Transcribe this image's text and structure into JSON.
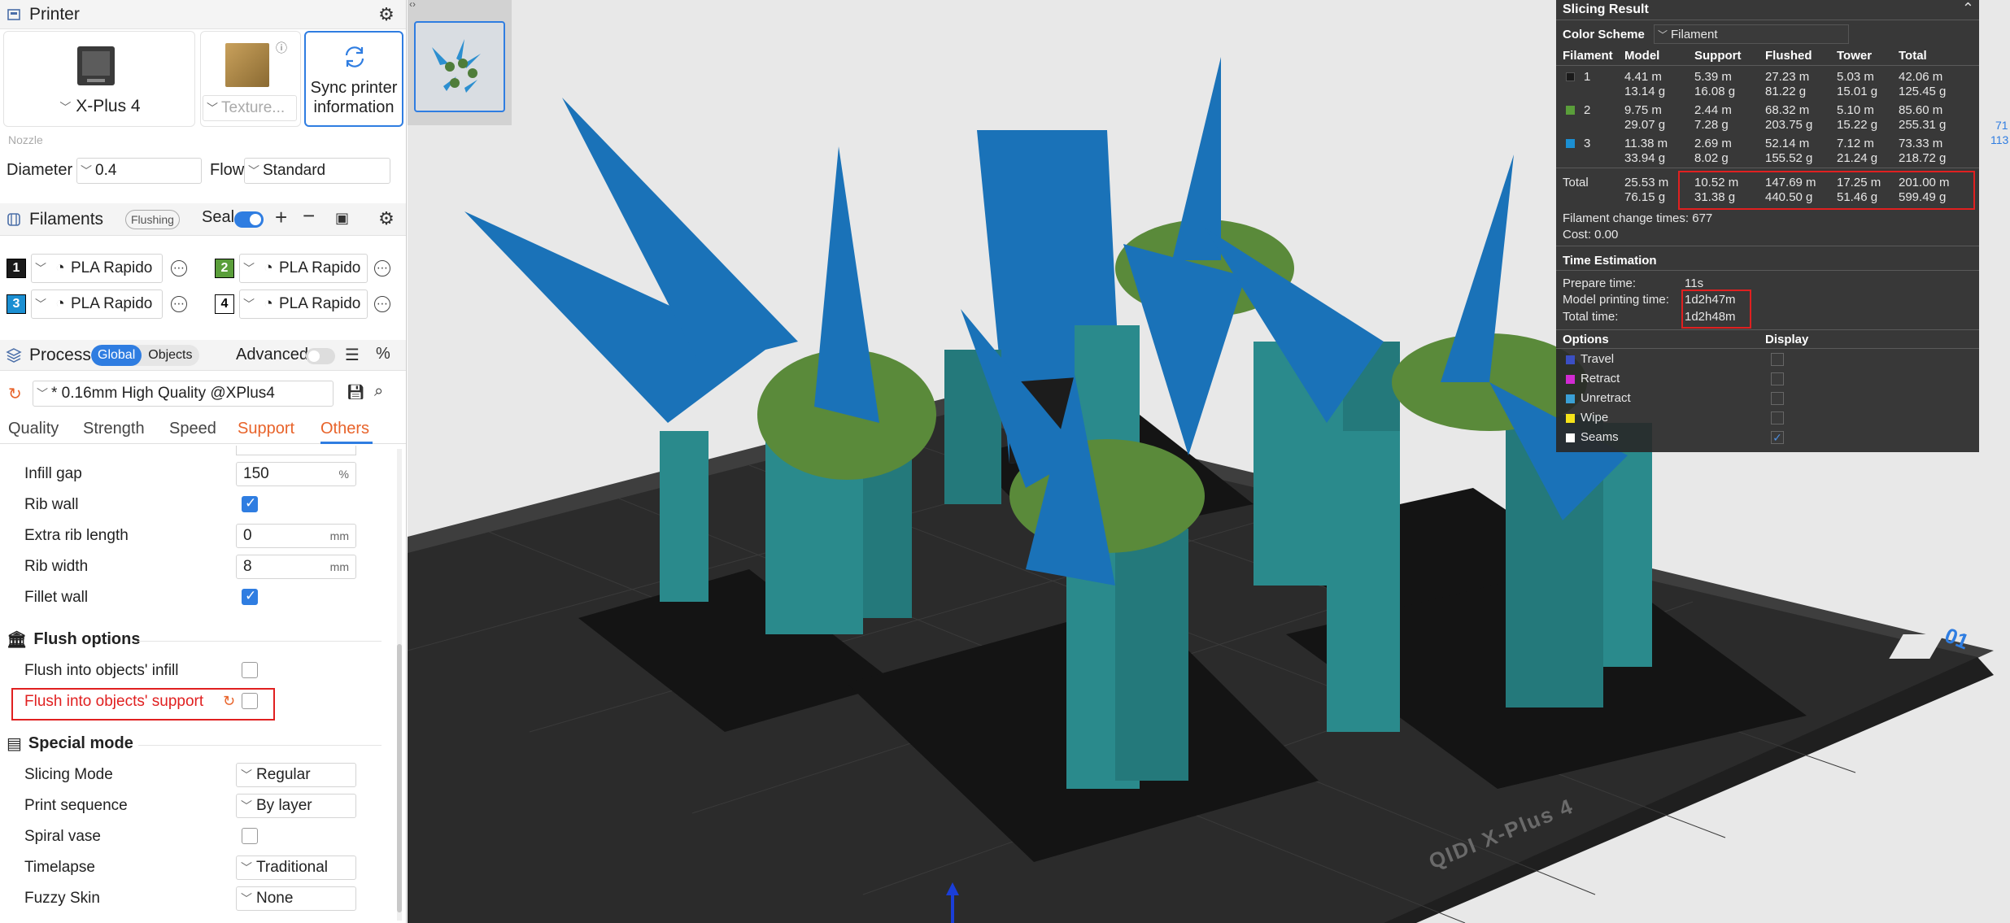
{
  "printer": {
    "section_title": "Printer",
    "printer_name": "X-Plus 4",
    "plate_type": "Texture...",
    "sync_label_1": "Sync printer",
    "sync_label_2": "information",
    "nozzle_label": "Nozzle",
    "diameter_label": "Diameter",
    "diameter_value": "0.4",
    "flow_label": "Flow",
    "flow_value": "Standard"
  },
  "filaments": {
    "section_title": "Filaments",
    "flushing_label": "Flushing",
    "seal_label": "Seal",
    "items": [
      {
        "slot": "1",
        "name": "PLA Rapido",
        "color": "#1a1a1a"
      },
      {
        "slot": "2",
        "name": "PLA Rapido",
        "color": "#5a9e3a"
      },
      {
        "slot": "3",
        "name": "PLA Rapido",
        "color": "#1b8fd2"
      },
      {
        "slot": "4",
        "name": "PLA Rapido",
        "color": "#ffffff"
      }
    ]
  },
  "process": {
    "section_title": "Process",
    "global_label": "Global",
    "objects_label": "Objects",
    "advanced_label": "Advanced",
    "preset": "* 0.16mm High Quality @XPlus4",
    "tabs": [
      "Quality",
      "Strength",
      "Speed",
      "Support",
      "Others"
    ]
  },
  "others": {
    "infill_gap_label": "Infill gap",
    "infill_gap_value": "150",
    "infill_gap_unit": "%",
    "rib_wall_label": "Rib wall",
    "extra_rib_label": "Extra rib length",
    "extra_rib_value": "0",
    "extra_rib_unit": "mm",
    "rib_width_label": "Rib width",
    "rib_width_value": "8",
    "rib_width_unit": "mm",
    "fillet_wall_label": "Fillet wall",
    "flush_title": "Flush options",
    "flush_infill_label": "Flush into objects' infill",
    "flush_support_label": "Flush into objects' support",
    "special_title": "Special mode",
    "slicing_mode_label": "Slicing Mode",
    "slicing_mode_value": "Regular",
    "print_seq_label": "Print sequence",
    "print_seq_value": "By layer",
    "spiral_label": "Spiral vase",
    "timelapse_label": "Timelapse",
    "timelapse_value": "Traditional",
    "fuzzy_label": "Fuzzy Skin",
    "fuzzy_value": "None"
  },
  "result": {
    "title": "Slicing Result",
    "color_scheme_label": "Color Scheme",
    "color_scheme_value": "Filament",
    "headers": [
      "Filament",
      "Model",
      "Support",
      "Flushed",
      "Tower",
      "Total"
    ],
    "rows": [
      {
        "id": "1",
        "color": "#1a1a1a",
        "model": [
          "4.41 m",
          "13.14 g"
        ],
        "support": [
          "5.39 m",
          "16.08 g"
        ],
        "flushed": [
          "27.23 m",
          "81.22 g"
        ],
        "tower": [
          "5.03 m",
          "15.01 g"
        ],
        "total": [
          "42.06 m",
          "125.45 g"
        ]
      },
      {
        "id": "2",
        "color": "#5a9e3a",
        "model": [
          "9.75 m",
          "29.07 g"
        ],
        "support": [
          "2.44 m",
          "7.28 g"
        ],
        "flushed": [
          "68.32 m",
          "203.75 g"
        ],
        "tower": [
          "5.10 m",
          "15.22 g"
        ],
        "total": [
          "85.60 m",
          "255.31 g"
        ]
      },
      {
        "id": "3",
        "color": "#1b8fd2",
        "model": [
          "11.38 m",
          "33.94 g"
        ],
        "support": [
          "2.69 m",
          "8.02 g"
        ],
        "flushed": [
          "52.14 m",
          "155.52 g"
        ],
        "tower": [
          "7.12 m",
          "21.24 g"
        ],
        "total": [
          "73.33 m",
          "218.72 g"
        ]
      }
    ],
    "total_label": "Total",
    "total": {
      "model": [
        "25.53 m",
        "76.15 g"
      ],
      "support": [
        "10.52 m",
        "31.38 g"
      ],
      "flushed": [
        "147.69 m",
        "440.50 g"
      ],
      "tower": [
        "17.25 m",
        "51.46 g"
      ],
      "total": [
        "201.00 m",
        "599.49 g"
      ]
    },
    "change_times": "Filament change times:  677",
    "cost": "Cost:  0.00",
    "time_title": "Time Estimation",
    "prepare_label": "Prepare time:",
    "prepare_value": "11s",
    "model_time_label": "Model printing time:",
    "model_time_value": "1d2h47m",
    "total_time_label": "Total time:",
    "total_time_value": "1d2h48m",
    "options_label": "Options",
    "display_label": "Display",
    "options": [
      {
        "name": "Travel",
        "color": "#3b4fc2"
      },
      {
        "name": "Retract",
        "color": "#d12bd1"
      },
      {
        "name": "Unretract",
        "color": "#3aa0d4"
      },
      {
        "name": "Wipe",
        "color": "#f5e31a"
      },
      {
        "name": "Seams",
        "color": "#ffffff"
      }
    ]
  },
  "plate": {
    "brand": "QIDI  X-Plus 4",
    "plate_number": "01",
    "edge_a": "71",
    "edge_b": "113"
  }
}
